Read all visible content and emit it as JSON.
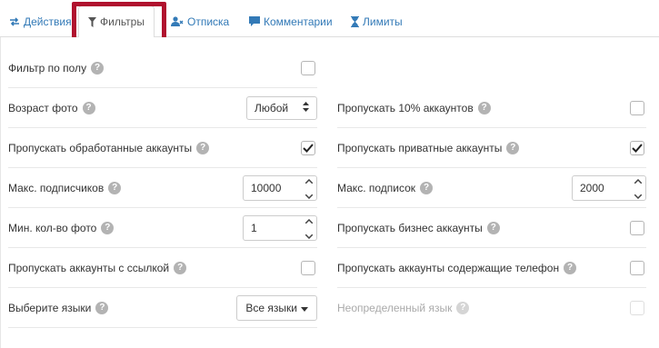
{
  "tabs": [
    {
      "label": "Действия",
      "icon": "arrows-exchange-icon"
    },
    {
      "label": "Фильтры",
      "icon": "filter-icon"
    },
    {
      "label": "Отписка",
      "icon": "user-remove-icon"
    },
    {
      "label": "Комментарии",
      "icon": "comment-icon"
    },
    {
      "label": "Лимиты",
      "icon": "hourglass-icon"
    }
  ],
  "colors": {
    "link": "#337ab7",
    "highlight": "#b0112e"
  },
  "left": {
    "gender_filter": {
      "label": "Фильтр по полу",
      "checked": false
    },
    "photo_age": {
      "label": "Возраст фото",
      "value": "Любой"
    },
    "skip_processed": {
      "label": "Пропускать обработанные аккаунты",
      "checked": true
    },
    "max_followers": {
      "label": "Макс. подписчиков",
      "value": "10000"
    },
    "min_photos": {
      "label": "Мин. кол-во фото",
      "value": "1"
    },
    "skip_with_link": {
      "label": "Пропускать аккаунты с ссылкой",
      "checked": false
    },
    "languages": {
      "label": "Выберите языки",
      "value": "Все языки"
    }
  },
  "right": {
    "skip_10": {
      "label": "Пропускать 10% аккаунтов",
      "checked": false
    },
    "skip_private": {
      "label": "Пропускать приватные аккаунты",
      "checked": true
    },
    "max_following": {
      "label": "Макс. подписок",
      "value": "2000"
    },
    "skip_business": {
      "label": "Пропускать бизнес аккаунты",
      "checked": false
    },
    "skip_phone": {
      "label": "Пропускать аккаунты содержащие телефон",
      "checked": false
    },
    "undefined_lang": {
      "label": "Неопределенный язык",
      "checked": false,
      "disabled": true
    }
  }
}
